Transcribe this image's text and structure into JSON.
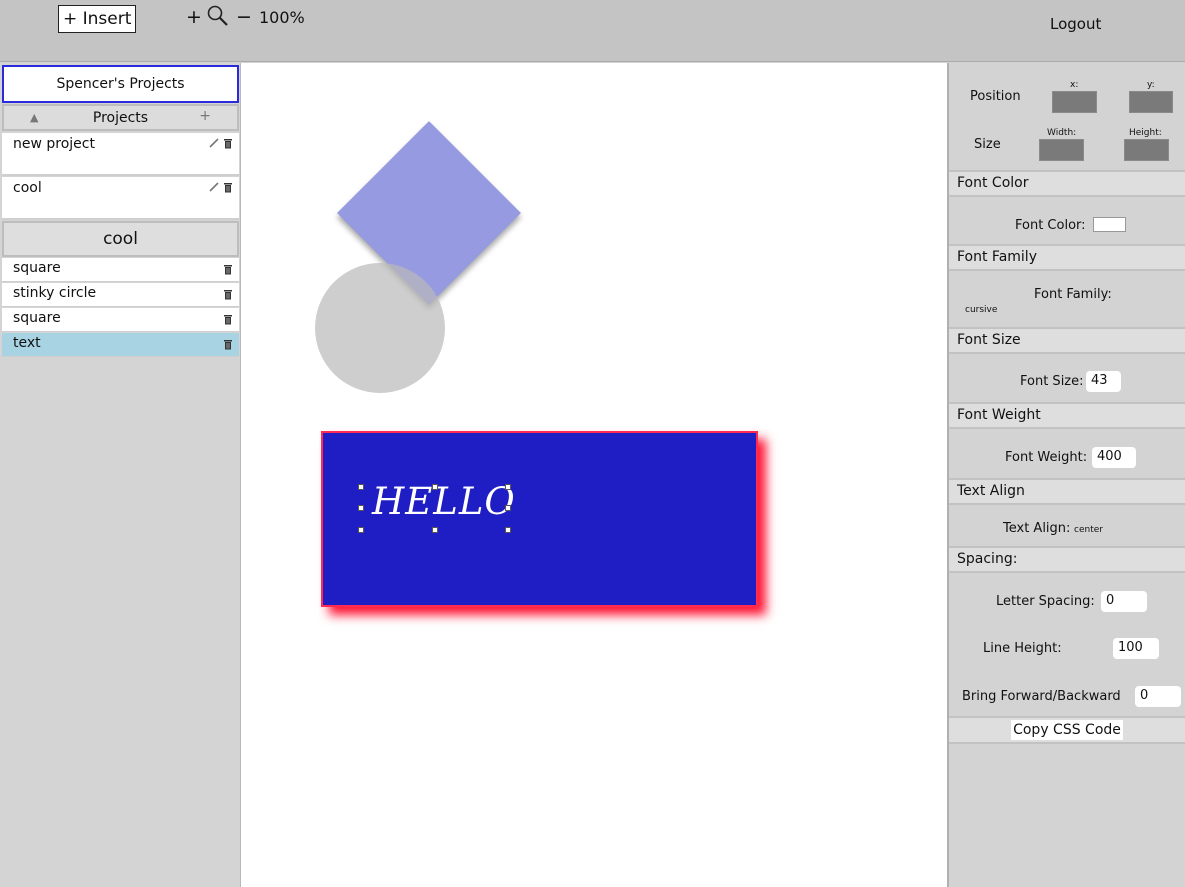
{
  "toolbar": {
    "insert_label": "+ Insert",
    "zoom_in_label": "+",
    "zoom_out_label": "−",
    "zoom_level": "100%",
    "logout_label": "Logout"
  },
  "sidebar": {
    "user_title": "Spencer's Projects",
    "projects_header": "Projects",
    "collapse_glyph": "▲",
    "add_glyph": "+",
    "projects": [
      {
        "name": "new project"
      },
      {
        "name": "cool"
      }
    ],
    "current_project": "cool",
    "layers": [
      {
        "name": "square",
        "selected": false
      },
      {
        "name": "stinky circle",
        "selected": false
      },
      {
        "name": "square",
        "selected": false
      },
      {
        "name": "text",
        "selected": true
      }
    ]
  },
  "canvas": {
    "text_content": "HELLO",
    "colors": {
      "diamond": "#7b80d9",
      "circle": "#c4c4c4",
      "rect_fill": "#1f1dc4",
      "rect_border": "#ff2b52",
      "text": "#ffffff"
    }
  },
  "panel": {
    "position_label": "Position",
    "x_label": "x:",
    "y_label": "y:",
    "size_label": "Size",
    "width_label": "Width:",
    "height_label": "Height:",
    "font_color_header": "Font Color",
    "font_color_label": "Font Color:",
    "font_family_header": "Font Family",
    "font_family_label": "Font Family:",
    "font_family_value": "cursive",
    "font_size_header": "Font Size",
    "font_size_label": "Font Size:",
    "font_size_value": "43",
    "font_weight_header": "Font Weight",
    "font_weight_label": "Font Weight:",
    "font_weight_value": "400",
    "text_align_header": "Text Align",
    "text_align_label": "Text Align:",
    "text_align_value": "center",
    "spacing_header": "Spacing:",
    "letter_spacing_label": "Letter Spacing:",
    "letter_spacing_value": "0",
    "line_height_label": "Line Height:",
    "line_height_value": "100",
    "bring_label": "Bring Forward/Backward",
    "bring_value": "0",
    "copy_css_label": "Copy CSS Code"
  }
}
